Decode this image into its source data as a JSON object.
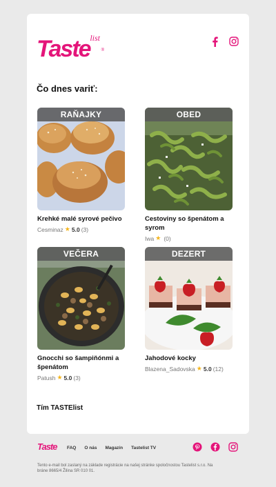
{
  "brand": {
    "logo_main": "Taste",
    "logo_sub": "list",
    "color": "#e4157a"
  },
  "social_top": [
    {
      "icon": "facebook-icon"
    },
    {
      "icon": "instagram-icon"
    }
  ],
  "heading": "Čo dnes variť:",
  "tiles": [
    {
      "category": "RAŇAJKY",
      "title": "Krehké malé syrové pečivo",
      "author": "Cesminaz",
      "rating": "5.0",
      "count": "(3)"
    },
    {
      "category": "OBED",
      "title": "Cestoviny so špenátom a syrom",
      "author": "Iwa",
      "rating": "",
      "count": "(0)"
    },
    {
      "category": "VEČERA",
      "title": "Gnocchi so šampiňónmi a špenátom",
      "author": "Patush",
      "rating": "5.0",
      "count": "(3)"
    },
    {
      "category": "DEZERT",
      "title": "Jahodové kocky",
      "author": "Blazena_Sadovska",
      "rating": "5.0",
      "count": "(12)"
    }
  ],
  "signature": "Tím TASTElist",
  "footer": {
    "logo": "Taste",
    "links": [
      "FAQ",
      "O nás",
      "Magazín",
      "Tastelist TV"
    ],
    "legal": "Tento e-mail bol zaslaný na základe registrácie na našej stránke spoločnostou Tastelist s.r.o. Na bráne 8665/4 Žilina SR 010 01."
  }
}
